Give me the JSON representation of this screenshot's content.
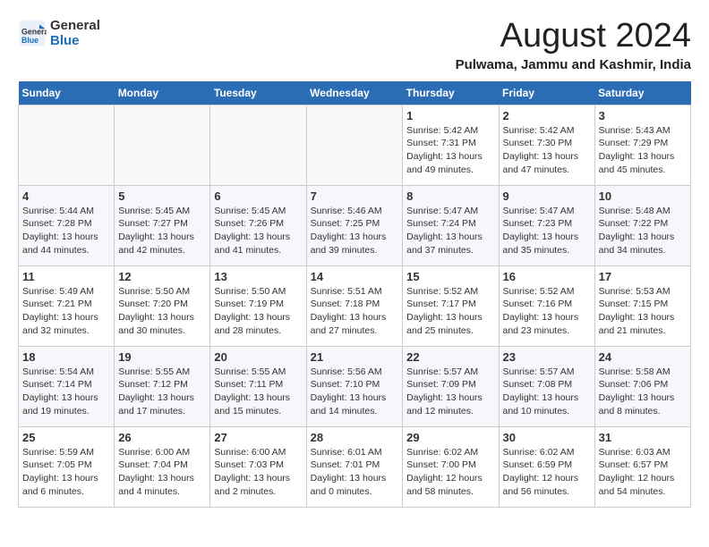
{
  "logo": {
    "line1": "General",
    "line2": "Blue"
  },
  "header": {
    "month_year": "August 2024",
    "location": "Pulwama, Jammu and Kashmir, India"
  },
  "days_of_week": [
    "Sunday",
    "Monday",
    "Tuesday",
    "Wednesday",
    "Thursday",
    "Friday",
    "Saturday"
  ],
  "weeks": [
    [
      {
        "day": "",
        "text": ""
      },
      {
        "day": "",
        "text": ""
      },
      {
        "day": "",
        "text": ""
      },
      {
        "day": "",
        "text": ""
      },
      {
        "day": "1",
        "text": "Sunrise: 5:42 AM\nSunset: 7:31 PM\nDaylight: 13 hours and 49 minutes."
      },
      {
        "day": "2",
        "text": "Sunrise: 5:42 AM\nSunset: 7:30 PM\nDaylight: 13 hours and 47 minutes."
      },
      {
        "day": "3",
        "text": "Sunrise: 5:43 AM\nSunset: 7:29 PM\nDaylight: 13 hours and 45 minutes."
      }
    ],
    [
      {
        "day": "4",
        "text": "Sunrise: 5:44 AM\nSunset: 7:28 PM\nDaylight: 13 hours and 44 minutes."
      },
      {
        "day": "5",
        "text": "Sunrise: 5:45 AM\nSunset: 7:27 PM\nDaylight: 13 hours and 42 minutes."
      },
      {
        "day": "6",
        "text": "Sunrise: 5:45 AM\nSunset: 7:26 PM\nDaylight: 13 hours and 41 minutes."
      },
      {
        "day": "7",
        "text": "Sunrise: 5:46 AM\nSunset: 7:25 PM\nDaylight: 13 hours and 39 minutes."
      },
      {
        "day": "8",
        "text": "Sunrise: 5:47 AM\nSunset: 7:24 PM\nDaylight: 13 hours and 37 minutes."
      },
      {
        "day": "9",
        "text": "Sunrise: 5:47 AM\nSunset: 7:23 PM\nDaylight: 13 hours and 35 minutes."
      },
      {
        "day": "10",
        "text": "Sunrise: 5:48 AM\nSunset: 7:22 PM\nDaylight: 13 hours and 34 minutes."
      }
    ],
    [
      {
        "day": "11",
        "text": "Sunrise: 5:49 AM\nSunset: 7:21 PM\nDaylight: 13 hours and 32 minutes."
      },
      {
        "day": "12",
        "text": "Sunrise: 5:50 AM\nSunset: 7:20 PM\nDaylight: 13 hours and 30 minutes."
      },
      {
        "day": "13",
        "text": "Sunrise: 5:50 AM\nSunset: 7:19 PM\nDaylight: 13 hours and 28 minutes."
      },
      {
        "day": "14",
        "text": "Sunrise: 5:51 AM\nSunset: 7:18 PM\nDaylight: 13 hours and 27 minutes."
      },
      {
        "day": "15",
        "text": "Sunrise: 5:52 AM\nSunset: 7:17 PM\nDaylight: 13 hours and 25 minutes."
      },
      {
        "day": "16",
        "text": "Sunrise: 5:52 AM\nSunset: 7:16 PM\nDaylight: 13 hours and 23 minutes."
      },
      {
        "day": "17",
        "text": "Sunrise: 5:53 AM\nSunset: 7:15 PM\nDaylight: 13 hours and 21 minutes."
      }
    ],
    [
      {
        "day": "18",
        "text": "Sunrise: 5:54 AM\nSunset: 7:14 PM\nDaylight: 13 hours and 19 minutes."
      },
      {
        "day": "19",
        "text": "Sunrise: 5:55 AM\nSunset: 7:12 PM\nDaylight: 13 hours and 17 minutes."
      },
      {
        "day": "20",
        "text": "Sunrise: 5:55 AM\nSunset: 7:11 PM\nDaylight: 13 hours and 15 minutes."
      },
      {
        "day": "21",
        "text": "Sunrise: 5:56 AM\nSunset: 7:10 PM\nDaylight: 13 hours and 14 minutes."
      },
      {
        "day": "22",
        "text": "Sunrise: 5:57 AM\nSunset: 7:09 PM\nDaylight: 13 hours and 12 minutes."
      },
      {
        "day": "23",
        "text": "Sunrise: 5:57 AM\nSunset: 7:08 PM\nDaylight: 13 hours and 10 minutes."
      },
      {
        "day": "24",
        "text": "Sunrise: 5:58 AM\nSunset: 7:06 PM\nDaylight: 13 hours and 8 minutes."
      }
    ],
    [
      {
        "day": "25",
        "text": "Sunrise: 5:59 AM\nSunset: 7:05 PM\nDaylight: 13 hours and 6 minutes."
      },
      {
        "day": "26",
        "text": "Sunrise: 6:00 AM\nSunset: 7:04 PM\nDaylight: 13 hours and 4 minutes."
      },
      {
        "day": "27",
        "text": "Sunrise: 6:00 AM\nSunset: 7:03 PM\nDaylight: 13 hours and 2 minutes."
      },
      {
        "day": "28",
        "text": "Sunrise: 6:01 AM\nSunset: 7:01 PM\nDaylight: 13 hours and 0 minutes."
      },
      {
        "day": "29",
        "text": "Sunrise: 6:02 AM\nSunset: 7:00 PM\nDaylight: 12 hours and 58 minutes."
      },
      {
        "day": "30",
        "text": "Sunrise: 6:02 AM\nSunset: 6:59 PM\nDaylight: 12 hours and 56 minutes."
      },
      {
        "day": "31",
        "text": "Sunrise: 6:03 AM\nSunset: 6:57 PM\nDaylight: 12 hours and 54 minutes."
      }
    ]
  ]
}
